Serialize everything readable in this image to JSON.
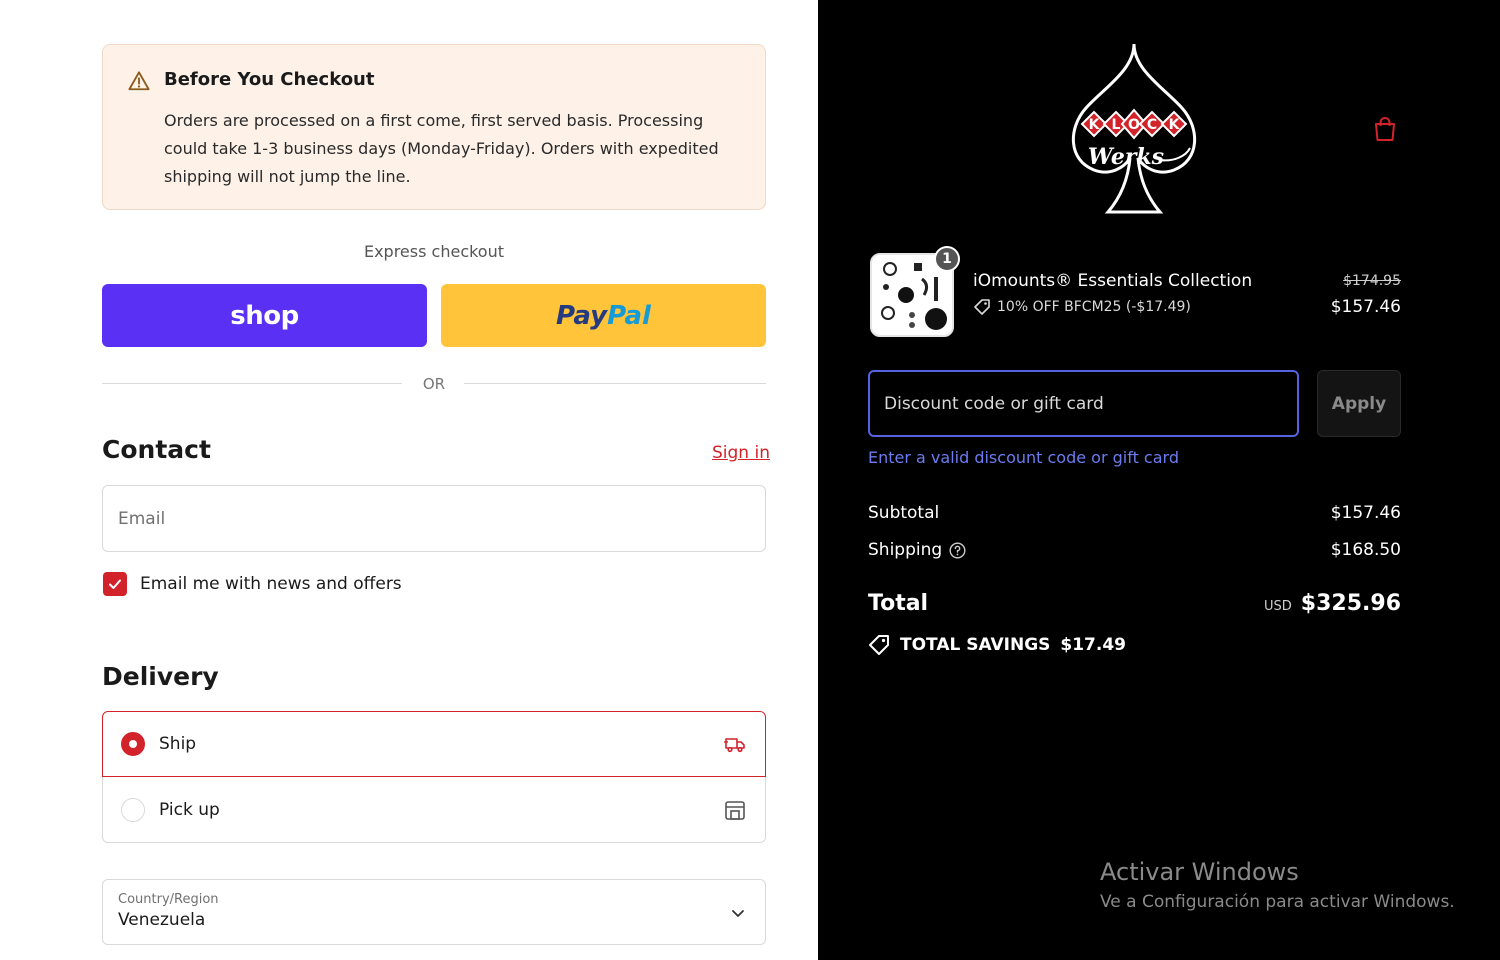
{
  "notice": {
    "title": "Before You Checkout",
    "body": "Orders are processed on a first come, first served basis. Processing could take 1-3 business days (Monday-Friday). Orders with expedited shipping will not jump the line."
  },
  "express": {
    "label": "Express checkout",
    "shop_label": "shop",
    "paypal_part1": "Pay",
    "paypal_part2": "Pal",
    "or_label": "OR"
  },
  "contact": {
    "heading": "Contact",
    "sign_in": "Sign in",
    "email_placeholder": "Email",
    "news_label": "Email me with news and offers",
    "news_checked": true
  },
  "delivery": {
    "heading": "Delivery",
    "options": [
      {
        "label": "Ship",
        "selected": true,
        "icon": "truck-icon"
      },
      {
        "label": "Pick up",
        "selected": false,
        "icon": "store-icon"
      }
    ],
    "country_label": "Country/Region",
    "country_value": "Venezuela"
  },
  "cart": {
    "logo_text": "KLOCK Werks",
    "item": {
      "name": "iOmounts® Essentials Collection",
      "quantity": "1",
      "discount": "10% OFF BFCM25 (-$17.49)",
      "price_original": "$174.95",
      "price_final": "$157.46"
    },
    "discount_placeholder": "Discount code or gift card",
    "apply_label": "Apply",
    "discount_error": "Enter a valid discount code or gift card",
    "subtotal_label": "Subtotal",
    "subtotal_value": "$157.46",
    "shipping_label": "Shipping",
    "shipping_value": "$168.50",
    "total_label": "Total",
    "currency": "USD",
    "total_value": "$325.96",
    "savings_label": "TOTAL SAVINGS",
    "savings_value": "$17.49"
  },
  "windows_watermark": {
    "line1": "Activar Windows",
    "line2": "Ve a Configuración para activar Windows."
  },
  "colors": {
    "accent_red": "#d2232a",
    "shop_purple": "#5a31f4",
    "paypal_yellow": "#ffc439",
    "focus_blue": "#5563e0"
  }
}
